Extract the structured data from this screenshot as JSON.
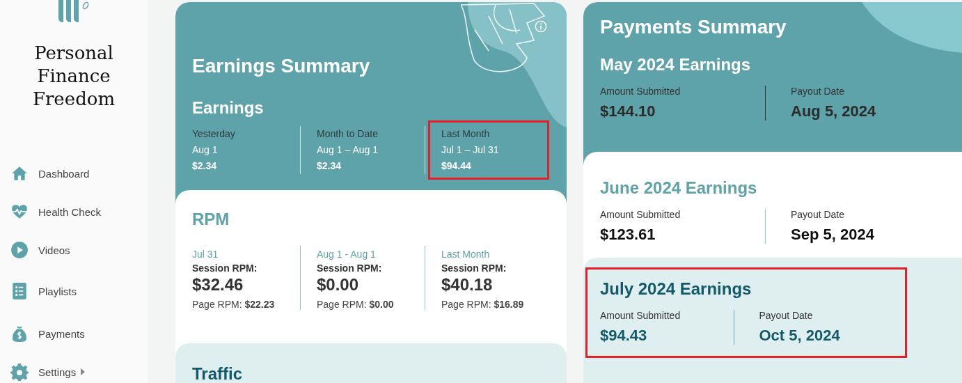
{
  "sidebar": {
    "brand": "Personal Finance Freedom",
    "nav": [
      {
        "label": "Dashboard",
        "has_submenu": false
      },
      {
        "label": "Health Check",
        "has_submenu": false
      },
      {
        "label": "Videos",
        "has_submenu": false
      },
      {
        "label": "Playlists",
        "has_submenu": false
      },
      {
        "label": "Payments",
        "has_submenu": false
      },
      {
        "label": "Settings",
        "has_submenu": true
      }
    ]
  },
  "earnings_summary": {
    "title": "Earnings Summary",
    "earnings": {
      "heading": "Earnings",
      "periods": [
        {
          "label": "Yesterday",
          "date": "Aug 1",
          "amount": "$2.34",
          "highlighted": false
        },
        {
          "label": "Month to Date",
          "date": "Aug 1 – Aug 1",
          "amount": "$2.34",
          "highlighted": false
        },
        {
          "label": "Last Month",
          "date": "Jul 1 – Jul 31",
          "amount": "$94.44",
          "highlighted": true
        }
      ]
    },
    "rpm": {
      "heading": "RPM",
      "periods": [
        {
          "date": "Jul 31",
          "session_label": "Session RPM:",
          "session_value": "$32.46",
          "page_rpm": "Page RPM: **$22.23**"
        },
        {
          "date": "Aug 1 - Aug 1",
          "session_label": "Session RPM:",
          "session_value": "$0.00",
          "page_rpm": "Page RPM: **$0.00**"
        },
        {
          "date": "Last Month",
          "session_label": "Session RPM:",
          "session_value": "$40.18",
          "page_rpm": "Page RPM: **$16.89**"
        }
      ]
    },
    "traffic": {
      "heading": "Traffic"
    }
  },
  "payments_summary": {
    "title": "Payments Summary",
    "months": [
      {
        "heading": "May 2024 Earnings",
        "kind": "teal",
        "amount_label": "Amount Submitted",
        "amount": "$144.10",
        "date_label": "Payout Date",
        "date": "Aug 5, 2024",
        "highlighted": false
      },
      {
        "heading": "June 2024 Earnings",
        "kind": "white",
        "amount_label": "Amount Submitted",
        "amount": "$123.61",
        "date_label": "Payout Date",
        "date": "Sep 5, 2024",
        "highlighted": false
      },
      {
        "heading": "July 2024 Earnings",
        "kind": "light",
        "amount_label": "Amount Submitted",
        "amount": "$94.43",
        "date_label": "Payout Date",
        "date": "Oct 5, 2024",
        "highlighted": true
      }
    ]
  }
}
